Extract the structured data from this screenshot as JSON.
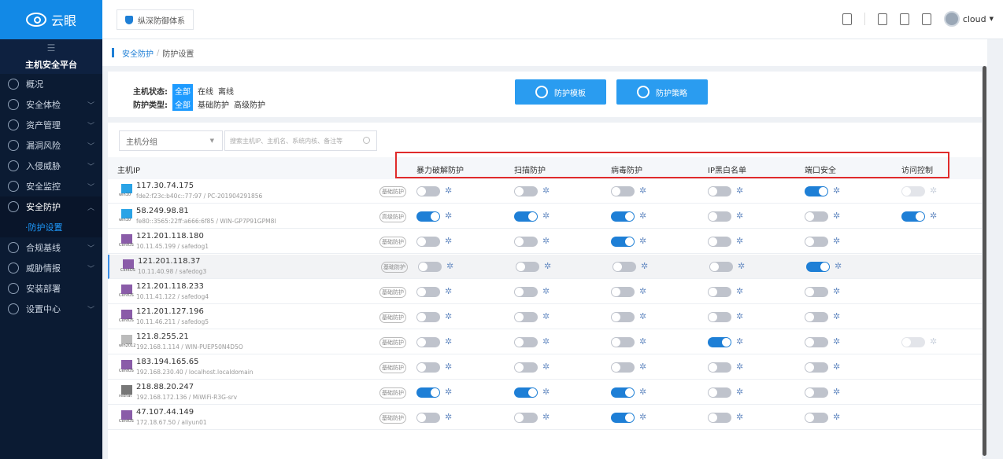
{
  "brand": {
    "name": "云眼"
  },
  "sidebar": {
    "platform": "主机安全平台",
    "items": [
      {
        "label": "概况",
        "chev": false
      },
      {
        "label": "安全体检",
        "chev": true
      },
      {
        "label": "资产管理",
        "chev": true
      },
      {
        "label": "漏洞风险",
        "chev": true
      },
      {
        "label": "入侵威胁",
        "chev": true
      },
      {
        "label": "安全监控",
        "chev": true
      },
      {
        "label": "安全防护",
        "chev": true,
        "active": true
      },
      {
        "label": "·防护设置",
        "sub": true
      },
      {
        "label": "合规基线",
        "chev": true
      },
      {
        "label": "威胁情报",
        "chev": true
      },
      {
        "label": "安装部署",
        "chev": false
      },
      {
        "label": "设置中心",
        "chev": true
      }
    ]
  },
  "topbar": {
    "system_tab": "纵深防御体系",
    "user": "cloud"
  },
  "breadcrumb": {
    "parent": "安全防护",
    "separator": "/",
    "current": "防护设置"
  },
  "filter": {
    "status_label": "主机状态:",
    "status_options": [
      "全部",
      "在线",
      "离线"
    ],
    "type_label": "防护类型:",
    "type_options": [
      "全部",
      "基础防护",
      "高级防护"
    ],
    "template_btn": "防护模板",
    "policy_btn": "防护策略"
  },
  "toolbar": {
    "group_placeholder": "主机分组",
    "search_placeholder": "搜索主机IP、主机名、系统内核、备注等"
  },
  "table": {
    "host_col": "主机IP",
    "columns": [
      "暴力破解防护",
      "扫描防护",
      "病毒防护",
      "IP黑白名单",
      "端口安全",
      "访问控制"
    ],
    "rows": [
      {
        "os": "win10",
        "ip": "117.30.74.175",
        "sub": "fde2:f23c:b40c::77:97 / PC-201904291856",
        "tag": "基础防护",
        "sw": [
          "off",
          "off",
          "off",
          "off",
          "on",
          "dis"
        ]
      },
      {
        "os": "win10",
        "ip": "58.249.98.81",
        "sub": "fe80::3565:22ff:a666:6f85 / WIN-GP7P91GPM8I",
        "tag": "高级防护",
        "sw": [
          "on",
          "on",
          "on",
          "off",
          "off",
          "on"
        ]
      },
      {
        "os": "CentOS",
        "ip": "121.201.118.180",
        "sub": "10.11.45.199 / safedog1",
        "tag": "基础防护",
        "sw": [
          "off",
          "off",
          "on",
          "off",
          "off",
          ""
        ]
      },
      {
        "os": "CentOS",
        "ip": "121.201.118.37",
        "sub": "10.11.40.98 / safedog3",
        "tag": "基础防护",
        "sw": [
          "off",
          "off",
          "off",
          "off",
          "on",
          ""
        ],
        "hl": true
      },
      {
        "os": "CentOS",
        "ip": "121.201.118.233",
        "sub": "10.11.41.122 / safedog4",
        "tag": "基础防护",
        "sw": [
          "off",
          "off",
          "off",
          "off",
          "off",
          ""
        ]
      },
      {
        "os": "CentOS",
        "ip": "121.201.127.196",
        "sub": "10.11.46.211 / safedog5",
        "tag": "基础防护",
        "sw": [
          "off",
          "off",
          "off",
          "off",
          "off",
          ""
        ]
      },
      {
        "os": "win2012",
        "ip": "121.8.255.21",
        "sub": "192.168.1.114 / WIN-PUEP50N4D5O",
        "tag": "基础防护",
        "sw": [
          "off",
          "off",
          "off",
          "on",
          "off",
          "dis"
        ]
      },
      {
        "os": "CentOS",
        "ip": "183.194.165.65",
        "sub": "192.168.230.40 / localhost.localdomain",
        "tag": "基础防护",
        "sw": [
          "off",
          "off",
          "off",
          "off",
          "off",
          ""
        ]
      },
      {
        "os": "redhat",
        "ip": "218.88.20.247",
        "sub": "192.168.172.136 / MiWiFi-R3G-srv",
        "tag": "基础防护",
        "sw": [
          "on",
          "on",
          "on",
          "off",
          "off",
          ""
        ]
      },
      {
        "os": "CentOS",
        "ip": "47.107.44.149",
        "sub": "172.18.67.50 / aliyun01",
        "tag": "基础防护",
        "sw": [
          "off",
          "off",
          "on",
          "off",
          "off",
          ""
        ]
      }
    ]
  },
  "colors": {
    "accent": "#1e7fd6",
    "sidebar": "#0b1b33",
    "highlight_box": "#e02b2b"
  }
}
